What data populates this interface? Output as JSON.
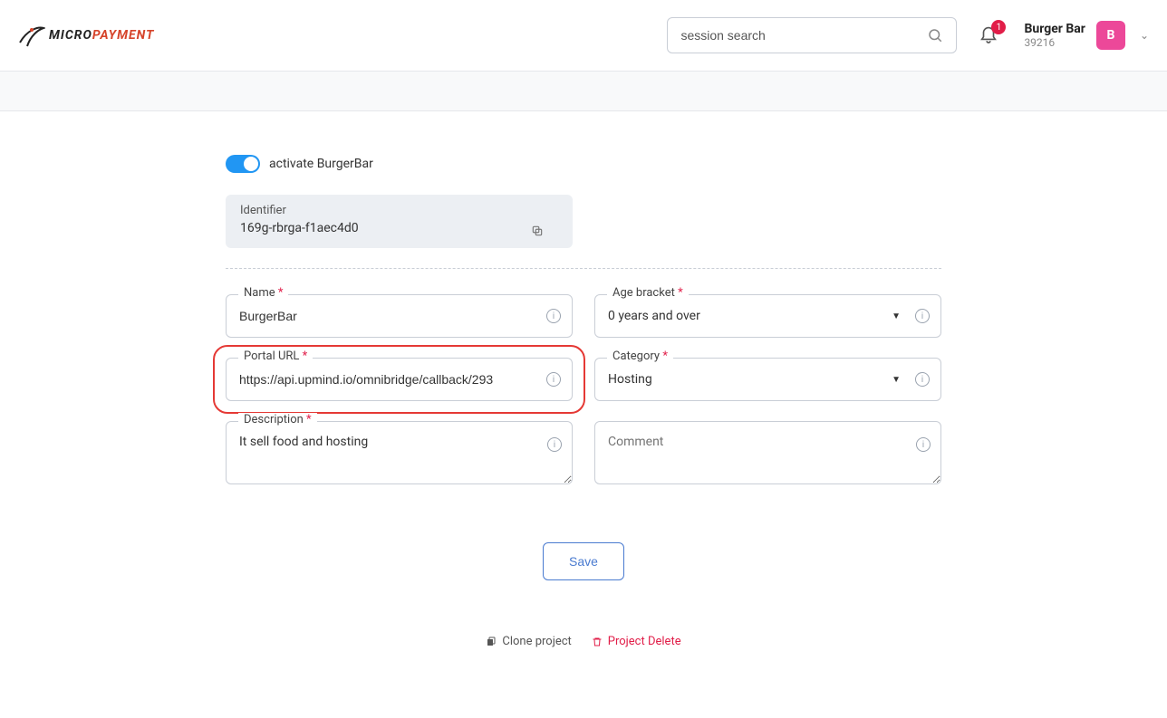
{
  "header": {
    "logo_micro": "MICRO",
    "logo_pay": "PAYMENT",
    "search_placeholder": "session search",
    "notification_count": "1",
    "user_name": "Burger Bar",
    "user_id": "39216",
    "avatar_letter": "B"
  },
  "form": {
    "toggle_label": "activate BurgerBar",
    "identifier_label": "Identifier",
    "identifier_value": "169g-rbrga-f1aec4d0",
    "name_label": "Name",
    "name_value": "BurgerBar",
    "age_label": "Age bracket",
    "age_value": "0 years and over",
    "portal_label": "Portal URL",
    "portal_value": "https://api.upmind.io/omnibridge/callback/293",
    "category_label": "Category",
    "category_value": "Hosting",
    "description_label": "Description",
    "description_value": "It sell food and hosting",
    "comment_label": "Comment",
    "comment_value": ""
  },
  "buttons": {
    "save": "Save",
    "clone": "Clone project",
    "delete": "Project Delete"
  }
}
